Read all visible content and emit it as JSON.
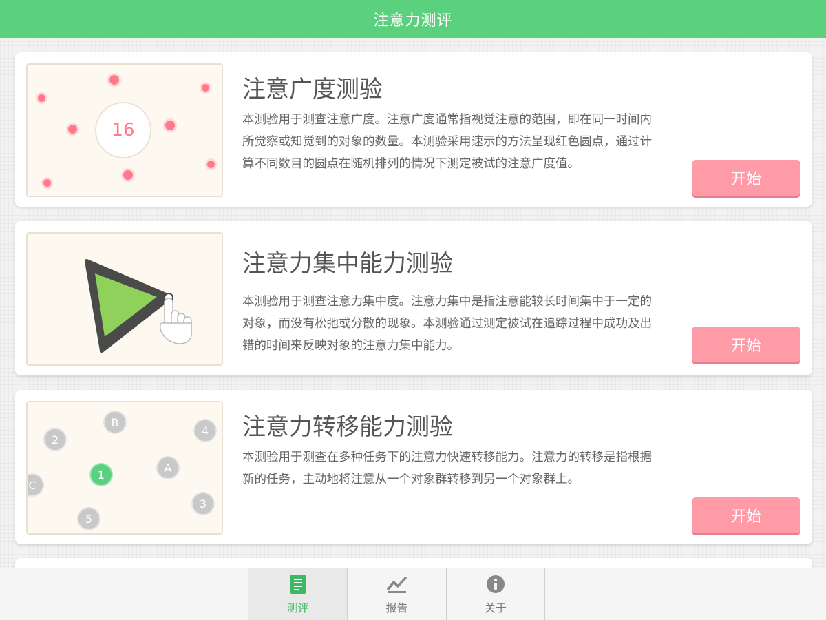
{
  "header": {
    "title": "注意力测评"
  },
  "cards": [
    {
      "title": "注意广度测验",
      "description": "本测验用于测查注意广度。注意广度通常指视觉注意的范围，即在同一时间内所觉察或知觉到的对象的数量。本测验采用速示的方法呈现红色圆点，通过计算不同数目的圆点在随机排列的情况下测定被试的注意广度值。",
      "button": "开始",
      "preview_number": "16"
    },
    {
      "title": "注意力集中能力测验",
      "description": "本测验用于测查注意力集中度。注意力集中是指注意能较长时间集中于一定的对象，而没有松弛或分散的现象。本测验通过测定被试在追踪过程中成功及出错的时间来反映对象的注意力集中能力。",
      "button": "开始"
    },
    {
      "title": "注意力转移能力测验",
      "description": "本测验用于测查在多种任务下的注意力快速转移能力。注意力的转移是指根据新的任务，主动地将注意从一个对象群转移到另一个对象群上。",
      "button": "开始",
      "balls": [
        "B",
        "2",
        "4",
        "A",
        "1",
        "C",
        "3",
        "5"
      ]
    }
  ],
  "tabs": [
    {
      "label": "测评",
      "icon": "document-icon",
      "active": true
    },
    {
      "label": "报告",
      "icon": "chart-icon",
      "active": false
    },
    {
      "label": "关于",
      "icon": "info-icon",
      "active": false
    }
  ],
  "colors": {
    "accent": "#5bd07f",
    "button": "#ff9aa7",
    "dot": "#ff7b8a"
  }
}
